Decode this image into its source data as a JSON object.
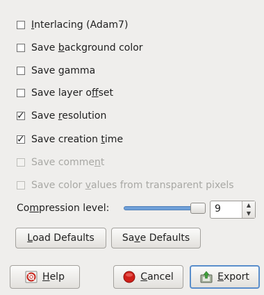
{
  "options": [
    {
      "pre": "",
      "mn": "I",
      "post": "nterlacing (Adam7)",
      "checked": false,
      "disabled": false
    },
    {
      "pre": "Save ",
      "mn": "b",
      "post": "ackground color",
      "checked": false,
      "disabled": false
    },
    {
      "pre": "Save ",
      "mn": "g",
      "post": "amma",
      "checked": false,
      "disabled": false
    },
    {
      "pre": "Save layer o",
      "mn": "f",
      "post": "fset",
      "checked": false,
      "disabled": false
    },
    {
      "pre": "Save ",
      "mn": "r",
      "post": "esolution",
      "checked": true,
      "disabled": false
    },
    {
      "pre": "Save creation ",
      "mn": "t",
      "post": "ime",
      "checked": true,
      "disabled": false
    },
    {
      "pre": "Save comme",
      "mn": "n",
      "post": "t",
      "checked": false,
      "disabled": true
    },
    {
      "pre": "Save color ",
      "mn": "v",
      "post": "alues from transparent pixels",
      "checked": false,
      "disabled": true
    }
  ],
  "compression": {
    "pre": "Co",
    "mn": "m",
    "post": "pression level:",
    "value": "9",
    "level_fraction": 1.0
  },
  "buttons": {
    "load_defaults": {
      "mn": "L",
      "rest": "oad Defaults"
    },
    "save_defaults": {
      "pre": "Sa",
      "mn": "v",
      "post": "e Defaults"
    },
    "help": {
      "mn": "H",
      "rest": "elp",
      "icon": "help-icon"
    },
    "cancel": {
      "mn": "C",
      "rest": "ancel",
      "icon": "cancel-icon"
    },
    "export": {
      "mn": "E",
      "rest": "xport",
      "icon": "export-icon"
    }
  },
  "colors": {
    "background": "#efeeec",
    "accent": "#5a8ecb",
    "slider_fill": "#6fa0d8",
    "cancel_red": "#d0201a"
  }
}
